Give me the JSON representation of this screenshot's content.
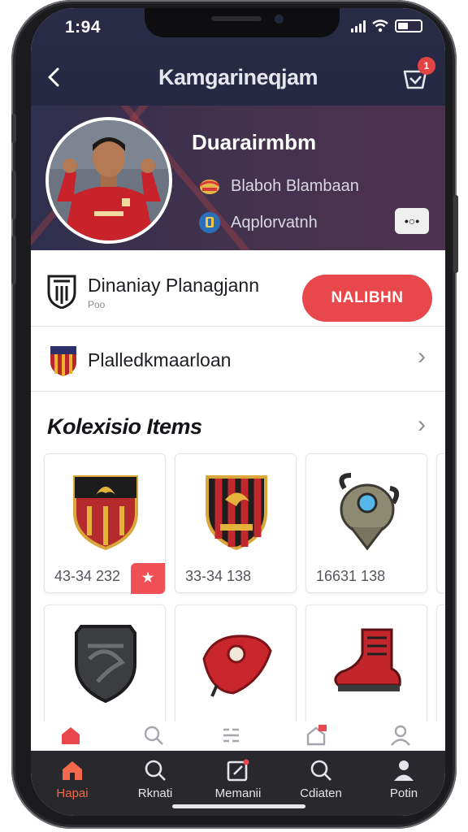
{
  "status_bar": {
    "time": "1:94"
  },
  "header": {
    "title": "Kamgarineqjam",
    "cart_badge": "1"
  },
  "profile": {
    "name": "Duarairmbm",
    "meta": [
      {
        "icon": "nation-flag-icon",
        "text": "Blaboh Blambaan"
      },
      {
        "icon": "club-crest-icon",
        "text": "Aqplorvatnh"
      }
    ],
    "share_label": "•○•"
  },
  "club": {
    "name": "Dinaniay Planagjann",
    "sub": "Poo",
    "follow_label": "NALIBHN"
  },
  "team": {
    "name": "Plalledkmaarloan"
  },
  "collection": {
    "title": "Kolexisio Items",
    "items": [
      {
        "icon": "crest-badge-icon",
        "price": "43-34 232",
        "tag": "★"
      },
      {
        "icon": "striped-shield-icon",
        "price": "33-34 138"
      },
      {
        "icon": "helmet-charm-icon",
        "price": "16631 138"
      },
      {
        "icon": "dark-shield-icon",
        "price": ""
      },
      {
        "icon": "red-cap-icon",
        "price": ""
      },
      {
        "icon": "red-boot-icon",
        "price": ""
      }
    ]
  },
  "tabs": [
    {
      "label": "Hapai",
      "icon": "home-icon",
      "active": true
    },
    {
      "label": "Rknati",
      "icon": "search-icon"
    },
    {
      "label": "Memanii",
      "icon": "edit-icon"
    },
    {
      "label": "Cdiaten",
      "icon": "search-icon"
    },
    {
      "label": "Potin",
      "icon": "profile-icon"
    }
  ],
  "colors": {
    "accent": "#e8484b",
    "header_bg": "#2a2c47",
    "tabbar_bg": "#29292d",
    "active_tab": "#f26a4b"
  }
}
